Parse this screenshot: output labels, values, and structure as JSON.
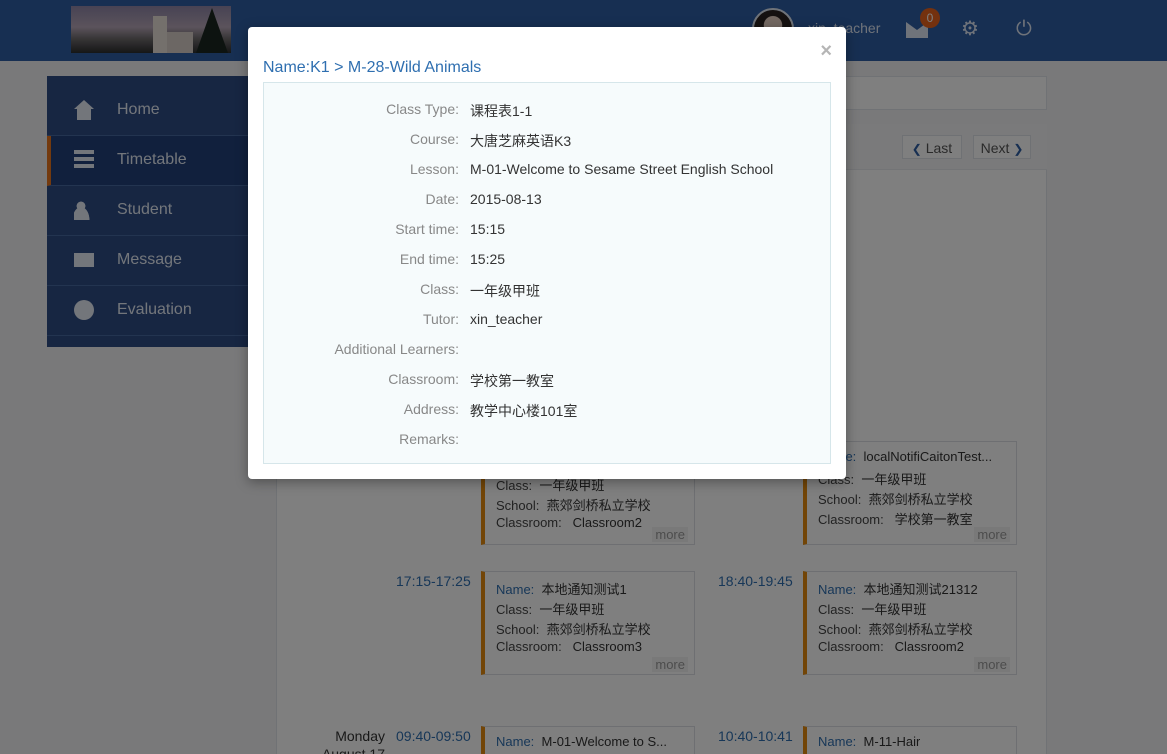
{
  "header": {
    "username": "xin_teacher",
    "message_count": "0",
    "icons": {
      "mail": "mail-icon",
      "settings": "gear-icon",
      "logout": "power-icon"
    }
  },
  "sidebar": {
    "items": [
      {
        "label": "Home",
        "icon": "home-icon"
      },
      {
        "label": "Timetable",
        "icon": "list-icon",
        "active": true
      },
      {
        "label": "Student",
        "icon": "users-icon"
      },
      {
        "label": "Message",
        "icon": "mail-icon"
      },
      {
        "label": "Evaluation",
        "icon": "chat-icon"
      }
    ]
  },
  "timetable": {
    "last_label": "Last",
    "next_label": "Next",
    "day_label": "Monday",
    "day_date": "August 17",
    "field_labels": {
      "name": "Name:",
      "class": "Class:",
      "school": "School:",
      "classroom": "Classroom:"
    },
    "more_label": "more",
    "slots": [
      {
        "time": "",
        "name": "",
        "class": "一年级甲班",
        "school": "燕郊剑桥私立学校",
        "classroom": "Classroom2"
      },
      {
        "time": "",
        "name": "localNotifiCaitonTest...",
        "class": "一年级甲班",
        "school": "燕郊剑桥私立学校",
        "classroom": "学校第一教室"
      },
      {
        "time": "17:15-17:25",
        "name": "本地通知测试1",
        "class": "一年级甲班",
        "school": "燕郊剑桥私立学校",
        "classroom": "Classroom3"
      },
      {
        "time": "18:40-19:45",
        "name": "本地通知测试21312",
        "class": "一年级甲班",
        "school": "燕郊剑桥私立学校",
        "classroom": "Classroom2"
      },
      {
        "time": "09:40-09:50",
        "name": "M-01-Welcome to S..."
      },
      {
        "time": "10:40-10:41",
        "name": "M-11-Hair"
      }
    ]
  },
  "modal": {
    "close_symbol": "×",
    "title": "Name:K1 > M-28-Wild Animals",
    "fields": [
      {
        "label": "Class Type:",
        "value": "课程表1-1"
      },
      {
        "label": "Course:",
        "value": "大唐芝麻英语K3"
      },
      {
        "label": "Lesson:",
        "value": "M-01-Welcome to Sesame Street English School"
      },
      {
        "label": "Date:",
        "value": "2015-08-13"
      },
      {
        "label": "Start time:",
        "value": "15:15"
      },
      {
        "label": "End time:",
        "value": "15:25"
      },
      {
        "label": "Class:",
        "value": "一年级甲班"
      },
      {
        "label": "Tutor:",
        "value": "xin_teacher"
      },
      {
        "label": "Additional Learners:",
        "value": ""
      },
      {
        "label": "Classroom:",
        "value": "学校第一教室"
      },
      {
        "label": "Address:",
        "value": "教学中心楼101室"
      },
      {
        "label": "Remarks:",
        "value": ""
      }
    ]
  }
}
